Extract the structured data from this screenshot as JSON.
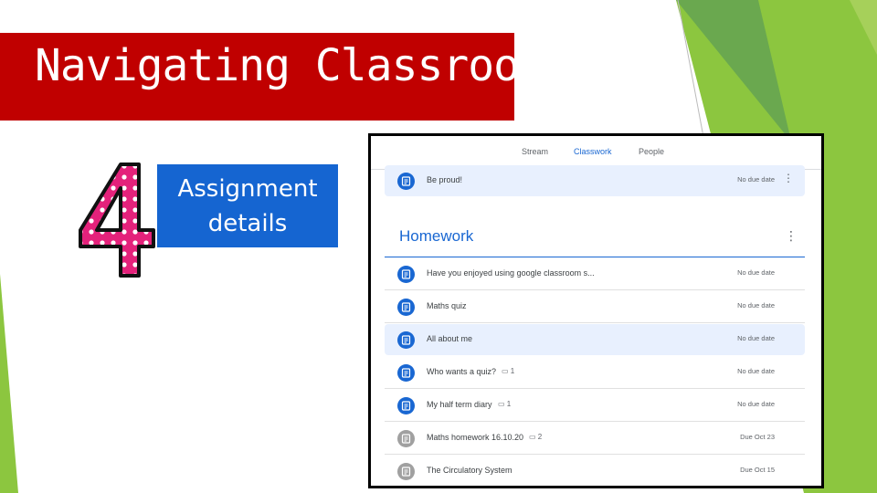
{
  "slide": {
    "title": "Navigating Classroom",
    "step_number": "4",
    "step_label_line1": "Assignment",
    "step_label_line2": "details",
    "accent_red": "#c00000",
    "accent_blue": "#1565d1",
    "accent_green": "#7ab648"
  },
  "classroom": {
    "tabs": [
      {
        "label": "Stream",
        "active": false
      },
      {
        "label": "Classwork",
        "active": true
      },
      {
        "label": "People",
        "active": false
      }
    ],
    "top_item": {
      "title": "Be proud!",
      "due": "No due date",
      "icon": "assignment-icon"
    },
    "section_title": "Homework",
    "items": [
      {
        "title": "Have you enjoyed using google classroom s...",
        "comments": "",
        "due": "No due date",
        "active": true,
        "highlight": false
      },
      {
        "title": "Maths quiz",
        "comments": "",
        "due": "No due date",
        "active": true,
        "highlight": false
      },
      {
        "title": "All about me",
        "comments": "",
        "due": "No due date",
        "active": true,
        "highlight": true
      },
      {
        "title": "Who wants a quiz?",
        "comments": "1",
        "due": "No due date",
        "active": true,
        "highlight": false
      },
      {
        "title": "My half term diary",
        "comments": "1",
        "due": "No due date",
        "active": true,
        "highlight": false
      },
      {
        "title": "Maths homework 16.10.20",
        "comments": "2",
        "due": "Due Oct 23",
        "active": false,
        "highlight": false
      },
      {
        "title": "The Circulatory System",
        "comments": "",
        "due": "Due Oct 15",
        "active": false,
        "highlight": false
      }
    ]
  }
}
